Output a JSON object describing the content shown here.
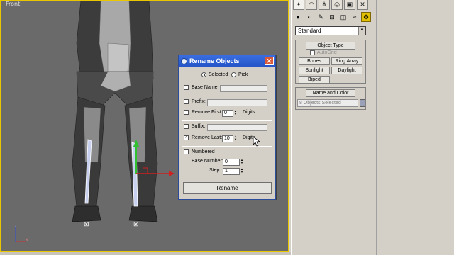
{
  "viewport": {
    "label": "Front",
    "figure_colors": {
      "body": "#3a3a3a",
      "light": "#bdbdbd",
      "mid": "#8a8a8a"
    }
  },
  "command_panel": {
    "tabs": [
      {
        "icon": "create-icon",
        "glyph": "✦",
        "active": true
      },
      {
        "icon": "modify-icon",
        "glyph": "◠",
        "active": false
      },
      {
        "icon": "hierarchy-icon",
        "glyph": "⋔",
        "active": false
      },
      {
        "icon": "motion-icon",
        "glyph": "◎",
        "active": false
      },
      {
        "icon": "display-icon",
        "glyph": "▣",
        "active": false
      },
      {
        "icon": "utilities-icon",
        "glyph": "✕",
        "active": false
      }
    ],
    "subcategories": [
      {
        "icon": "geometry-icon",
        "glyph": "●",
        "active": false
      },
      {
        "icon": "shapes-icon",
        "glyph": "◐",
        "active": false
      },
      {
        "icon": "lights-icon",
        "glyph": "✎",
        "active": false
      },
      {
        "icon": "cameras-icon",
        "glyph": "⊡",
        "active": false
      },
      {
        "icon": "helpers-icon",
        "glyph": "◫",
        "active": false
      },
      {
        "icon": "spacewarps-icon",
        "glyph": "≈",
        "active": false
      },
      {
        "icon": "systems-icon",
        "glyph": "⚙",
        "active": true
      }
    ],
    "type_dropdown": "Standard",
    "object_type": {
      "header": "Object Type",
      "autogrid_label": "AutoGrid",
      "buttons": [
        "Bones",
        "Ring Array",
        "Sunlight",
        "Daylight",
        "Biped"
      ]
    },
    "name_and_color": {
      "header": "Name and Color",
      "value": "8 Objects Selected",
      "color": "#9aa0b8"
    }
  },
  "dialog": {
    "title": "Rename Objects",
    "close_glyph": "✕",
    "scope": {
      "selected_label": "Selected",
      "pick_label": "Pick",
      "selected": "Selected"
    },
    "base_name": {
      "label": "Base Name:",
      "checked": false,
      "value": ""
    },
    "prefix": {
      "label": "Prefix:",
      "checked": false,
      "value": ""
    },
    "remove_first": {
      "label": "Remove First:",
      "checked": false,
      "value": "0",
      "unit": "Digits"
    },
    "suffix": {
      "label": "Suffix:",
      "checked": false,
      "value": ""
    },
    "remove_last": {
      "label": "Remove Last:",
      "checked": true,
      "value": "10",
      "unit": "Digits"
    },
    "numbered": {
      "label": "Numbered",
      "checked": false
    },
    "base_number": {
      "label": "Base Number:",
      "value": "0"
    },
    "step": {
      "label": "Step:",
      "value": "1"
    },
    "rename_button": "Rename",
    "check_glyph": "✓",
    "spin_up": "▲",
    "spin_down": "▼"
  }
}
